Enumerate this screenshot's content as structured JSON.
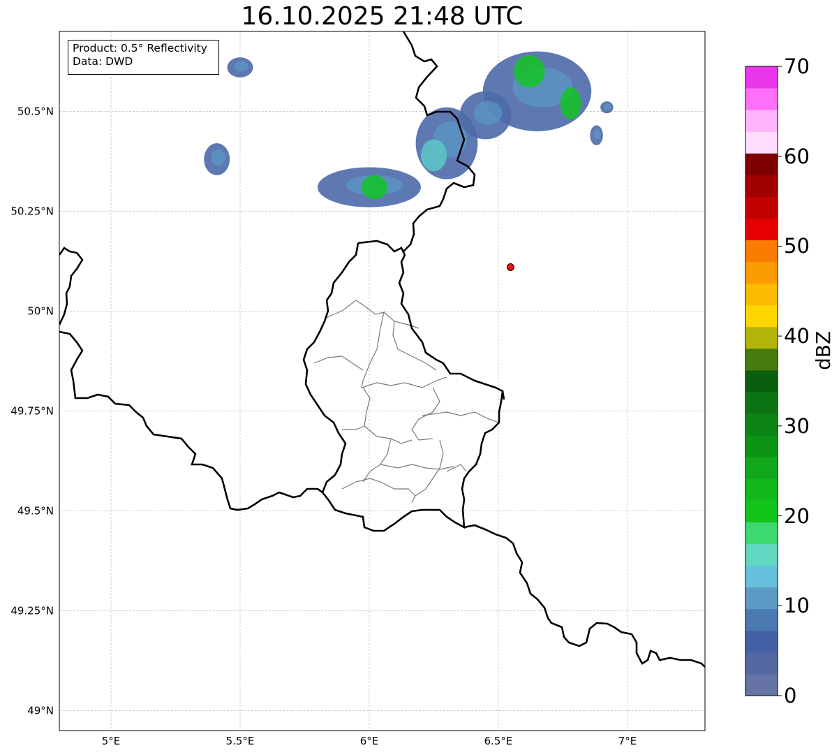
{
  "title": "16.10.2025 21:48 UTC",
  "info": {
    "product": "Product: 0.5° Reflectivity",
    "data": "Data: DWD"
  },
  "axes": {
    "lon_ticks": [
      {
        "value": 5.0,
        "label": "5°E"
      },
      {
        "value": 5.5,
        "label": "5.5°E"
      },
      {
        "value": 6.0,
        "label": "6°E"
      },
      {
        "value": 6.5,
        "label": "6.5°E"
      },
      {
        "value": 7.0,
        "label": "7°E"
      }
    ],
    "lat_ticks": [
      {
        "value": 50.5,
        "label": "50.5°N"
      },
      {
        "value": 50.25,
        "label": "50.25°N"
      },
      {
        "value": 50.0,
        "label": "50°N"
      },
      {
        "value": 49.75,
        "label": "49.75°N"
      },
      {
        "value": 49.5,
        "label": "49.5°N"
      },
      {
        "value": 49.25,
        "label": "49.25°N"
      },
      {
        "value": 49.0,
        "label": "49°N"
      }
    ],
    "lon_range": [
      4.8,
      7.3
    ],
    "lat_range": [
      48.95,
      50.7
    ]
  },
  "colorbar": {
    "unit": "dBZ",
    "range": [
      0,
      70
    ],
    "step": 2.5,
    "tick_labels": [
      "70",
      "60",
      "50",
      "40",
      "30",
      "20",
      "10",
      "0"
    ],
    "colors": [
      "#6573a7",
      "#5468a3",
      "#4460a5",
      "#4a7aaf",
      "#5c9ac5",
      "#66c2dc",
      "#62d8c2",
      "#3ed870",
      "#12c41c",
      "#12b91c",
      "#10a81a",
      "#0c9414",
      "#0d8414",
      "#0d7414",
      "#0a5e0e",
      "#477a0d",
      "#b2b40a",
      "#fdd600",
      "#fcba00",
      "#fc9c00",
      "#fb7d00",
      "#e40000",
      "#c20000",
      "#a20000",
      "#7c0000",
      "#ffdcfc",
      "#ffb4fc",
      "#ff6ff9",
      "#ea37ee"
    ]
  },
  "site": {
    "lon": 6.547,
    "lat": 50.11,
    "color": "#ee1111"
  },
  "echoes": [
    {
      "lon": 6.65,
      "lat": 50.55,
      "rx": 0.21,
      "ry": 0.1,
      "intensity": "light"
    },
    {
      "lon": 6.62,
      "lat": 50.6,
      "rx": 0.06,
      "ry": 0.04,
      "intensity": "moderate"
    },
    {
      "lon": 6.78,
      "lat": 50.52,
      "rx": 0.04,
      "ry": 0.04,
      "intensity": "moderate"
    },
    {
      "lon": 6.3,
      "lat": 50.42,
      "rx": 0.12,
      "ry": 0.09,
      "intensity": "light"
    },
    {
      "lon": 6.25,
      "lat": 50.39,
      "rx": 0.05,
      "ry": 0.04,
      "intensity": "medium"
    },
    {
      "lon": 6.0,
      "lat": 50.31,
      "rx": 0.2,
      "ry": 0.05,
      "intensity": "light"
    },
    {
      "lon": 6.02,
      "lat": 50.31,
      "rx": 0.05,
      "ry": 0.03,
      "intensity": "moderate"
    },
    {
      "lon": 5.5,
      "lat": 50.61,
      "rx": 0.05,
      "ry": 0.025,
      "intensity": "light"
    },
    {
      "lon": 5.41,
      "lat": 50.38,
      "rx": 0.05,
      "ry": 0.04,
      "intensity": "light"
    },
    {
      "lon": 6.45,
      "lat": 50.49,
      "rx": 0.1,
      "ry": 0.06,
      "intensity": "light"
    },
    {
      "lon": 6.88,
      "lat": 50.44,
      "rx": 0.025,
      "ry": 0.025,
      "intensity": "light"
    },
    {
      "lon": 6.92,
      "lat": 50.51,
      "rx": 0.025,
      "ry": 0.015,
      "intensity": "light"
    }
  ]
}
